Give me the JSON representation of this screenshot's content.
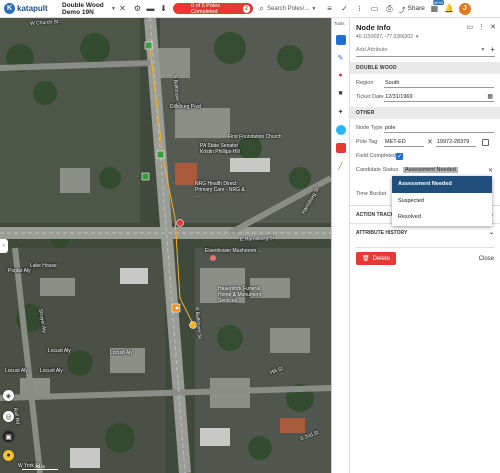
{
  "app": {
    "logo_text": "katapult",
    "logo_mark": "K"
  },
  "toolbar": {
    "job_name": "Double Wood Demo 19N",
    "progress_text": "0 of 5 Poles Completed",
    "progress_count": "2",
    "search_placeholder": "Search Poles/...",
    "share_label": "Share",
    "new_badge": "NEW",
    "avatar_initial": "J"
  },
  "map": {
    "labels": {
      "w_church": "W Church St",
      "e_harrisburg": "E Harrisburg St",
      "harrisburg_right": "Harrisburg St",
      "poplar_alley": "Poplar Aly",
      "locust_aly_1": "Locust Aly",
      "locust_aly_2": "Locust Aly",
      "locust_aly_3": "Locust Aly",
      "locust_aly_4": "Locust Aly",
      "w_york": "W York St",
      "railroad": "Rail Rd",
      "strayer": "Strayer Aly",
      "s_baltimore": "S Baltimore St",
      "n_baltimore": "N Baltimore St",
      "first_foundation": "First Foundation Church",
      "pa_state": "PA State Senator Kristin Phillips-Hill",
      "nrg": "NRG Health Direct Primary Care - NRG & ...",
      "dillsburg_post": "Dillsburg Post",
      "haaerstick": "Haaerstick Funeral Home & Monument Services",
      "lake_house": "Lake House",
      "eisenhower": "Eisenhower Mushroom ...",
      "hill_st": "Hill St",
      "s_2nd": "S 2nd St"
    },
    "scale": "25 m"
  },
  "tools": {
    "label": "Tools"
  },
  "panel": {
    "title": "Node Info",
    "coords": "40.1159027, -77.0356302",
    "add_attribute_placeholder": "Add Attribute",
    "section_double_wood": "DOUBLE WOOD",
    "region_label": "Region",
    "region_value": "South",
    "ticket_label": "Ticket Date",
    "ticket_value": "12/31/1969",
    "section_other": "OTHER",
    "node_type_label": "Node Type",
    "node_type_value": "pole",
    "pole_tag_label": "Pole Tag",
    "pole_tag_owner": "MET-ED",
    "pole_tag_value": "19972-28379",
    "field_completed_label": "Field Completed",
    "candidate_status_label": "Candidate Status",
    "candidate_status_value": "Assessment Needed",
    "time_bucket_label": "Time Bucket",
    "action_tracking": "ACTION TRACKI...",
    "attribute_history": "ATTRIBUTE HISTORY",
    "delete_label": "Delete",
    "close_label": "Close"
  },
  "dropdown": {
    "options": [
      "Assessment Needed",
      "Suspected",
      "Resolved"
    ],
    "selected": "Assessment Needed"
  },
  "colors": {
    "accent_red": "#e53935",
    "brand_blue": "#2a6fb5",
    "dropdown_selected": "#1f4f7a",
    "checkbox_blue": "#1e6fd0"
  }
}
